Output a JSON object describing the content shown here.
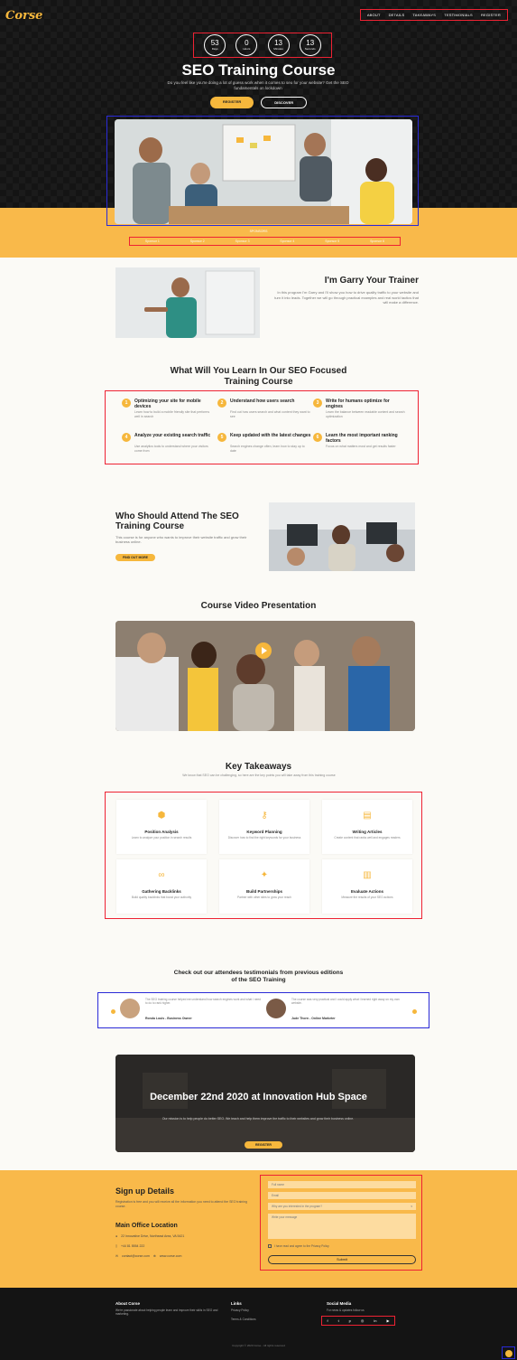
{
  "header": {
    "logo": "Corse",
    "nav": [
      "ABOUT",
      "DETAILS",
      "TAKEAWAYS",
      "TESTIMONIALS",
      "REGISTER"
    ]
  },
  "countdown": [
    {
      "value": "53",
      "unit": "Days"
    },
    {
      "value": "0",
      "unit": "Hours"
    },
    {
      "value": "13",
      "unit": "Minutes"
    },
    {
      "value": "13",
      "unit": "Seconds"
    }
  ],
  "hero": {
    "title": "SEO Training Course",
    "subtitle": "Do you feel like you're doing a lot of guess work when it comes to seo for your website? Get the SEO fundamentals on lockdown",
    "register": "REGISTER",
    "discover": "DISCOVER"
  },
  "brands": {
    "label": "SPONSORS",
    "items": [
      "Sponsor 1",
      "Sponsor 2",
      "Sponsor 3",
      "Sponsor 4",
      "Sponsor 5",
      "Sponsor 6"
    ]
  },
  "trainer": {
    "title": "I'm Garry Your Trainer",
    "text": "In this program I'm Garry and I'll show you how to drive quality traffic to your website and turn it into leads. Together we will go through practical examples and real world tactics that will make a difference."
  },
  "learn": {
    "title": "What Will You Learn In Our SEO Focused Training Course",
    "items": [
      {
        "num": "1",
        "head": "Optimizing your site for mobile devices",
        "desc": "Learn how to build a mobile friendly site that performs well in search"
      },
      {
        "num": "2",
        "head": "Understand how users search",
        "desc": "Find out how users search and what content they want to see"
      },
      {
        "num": "3",
        "head": "Write for humans optimize for engines",
        "desc": "Learn the balance between readable content and search optimization"
      },
      {
        "num": "4",
        "head": "Analyze your existing search traffic",
        "desc": "Use analytics tools to understand where your visitors come from"
      },
      {
        "num": "5",
        "head": "Keep updated with the latest changes",
        "desc": "Search engines change often, learn how to stay up to date"
      },
      {
        "num": "6",
        "head": "Learn the most important ranking factors",
        "desc": "Focus on what matters most and get results faster"
      }
    ]
  },
  "who": {
    "title": "Who Should Attend The SEO Training Course",
    "text": "This course is for anyone who wants to improve their website traffic and grow their business online.",
    "button": "FIND OUT MORE"
  },
  "video": {
    "title": "Course Video Presentation"
  },
  "takeaways": {
    "title": "Key Takeaways",
    "subtitle": "We know that SEO can be challenging, so here are the key points you will take away from this training course",
    "items": [
      {
        "icon": "cube-icon",
        "name": "Position Analysis",
        "desc": "Learn to analyze your position in search results"
      },
      {
        "icon": "key-icon",
        "name": "Keyword Planning",
        "desc": "Discover how to find the right keywords for your business"
      },
      {
        "icon": "document-icon",
        "name": "Writing Articles",
        "desc": "Create content that ranks well and engages readers"
      },
      {
        "icon": "link-icon",
        "name": "Gathering Backlinks",
        "desc": "Build quality backlinks that boost your authority"
      },
      {
        "icon": "handshake-icon",
        "name": "Build Partnerships",
        "desc": "Partner with other sites to grow your reach"
      },
      {
        "icon": "chart-icon",
        "name": "Evaluate Actions",
        "desc": "Measure the results of your SEO actions"
      }
    ]
  },
  "testimonials": {
    "title": "Check out our attendees testimonials from previous editions of the SEO Training",
    "items": [
      {
        "text": "The SEO training course helped me understand how search engines work and what I need to do to rank higher.",
        "name": "Ronda Louis - Business Owner"
      },
      {
        "text": "The course was very practical and I could apply what I learned right away on my own website.",
        "name": "Jude Thorn - Online Marketer"
      }
    ]
  },
  "event": {
    "title": "December 22nd 2020 at Innovation Hub Space",
    "text": "Our mission is to help people do better SEO. We teach and help them improve the traffic to their websites and grow their business online.",
    "button": "REGISTER"
  },
  "signup": {
    "title": "Sign up Details",
    "text": "Registration is free and you will receive all the information you need to attend the SEO training course.",
    "office_title": "Main Office Location",
    "address": "22 Innovative Drive, Northeast Area, VA 5421",
    "phone": "+44 81 5554 222",
    "email": "contact@corse.com",
    "website": "www.corse.com"
  },
  "form": {
    "name": "Full name",
    "email": "Email",
    "select": "Why are you interested in the program?",
    "message": "Write your message",
    "terms": "I have read and agree to the Privacy Policy",
    "submit": "Submit"
  },
  "footer": {
    "about_title": "About Corse",
    "about_text": "We're passionate about helping people learn and improve their skills in SEO and marketing.",
    "links_title": "Links",
    "links": [
      "Privacy Policy",
      "Terms & Conditions"
    ],
    "social_title": "Social Media",
    "social_text": "For news & updates follow us",
    "copyright": "Copyright © 2020 Corse - All rights reserved"
  },
  "colors": {
    "accent": "#f6b73c",
    "dark": "#141414",
    "band": "#f9b94a"
  }
}
